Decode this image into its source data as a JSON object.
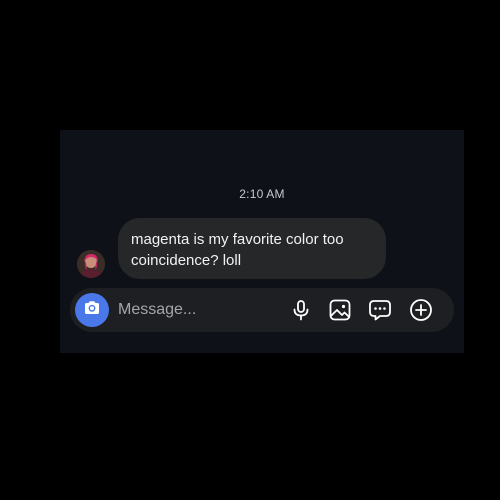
{
  "conversation": {
    "timestamp": "2:10 AM",
    "message": {
      "line1": "magenta is my favorite color too",
      "line2": "coincidence? loll"
    }
  },
  "composer": {
    "placeholder": "Message...",
    "value": "",
    "icons": {
      "camera": "camera-icon",
      "voice": "microphone-icon",
      "gallery": "image-icon",
      "sticker": "chat-bubble-icon",
      "more": "plus-circle-icon"
    }
  },
  "colors": {
    "background": "#000000",
    "panel": "#0e1117",
    "bubble": "#262729",
    "composer": "#1d1f22",
    "accent": "#4a78e8"
  }
}
